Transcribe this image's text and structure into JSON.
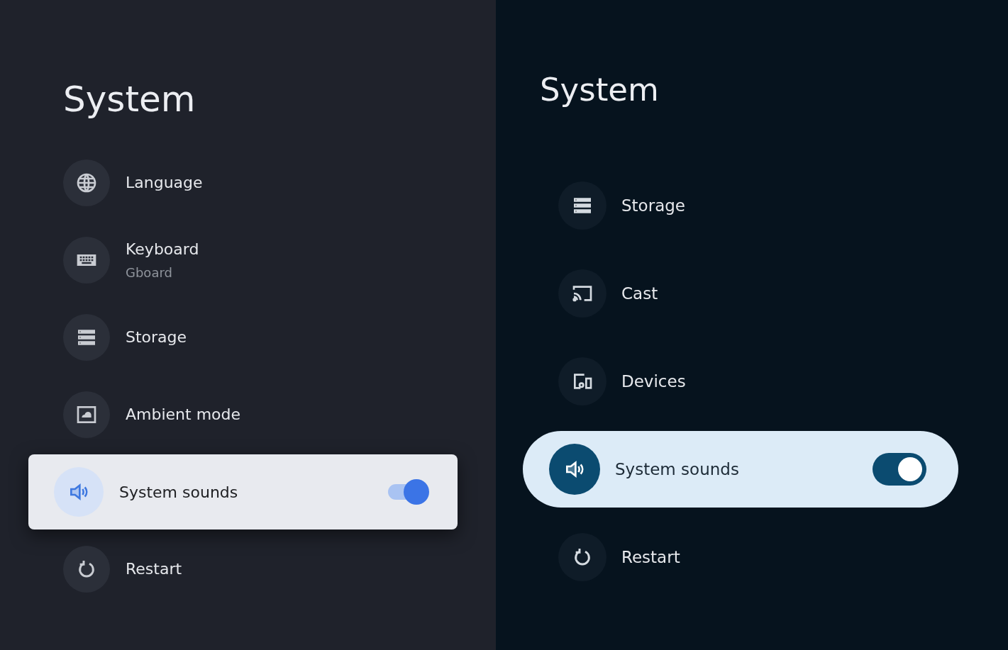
{
  "panels": [
    {
      "kind": "classic",
      "title": "System",
      "items": [
        {
          "kind": "globe",
          "label": "Language",
          "selected": false
        },
        {
          "kind": "keyboard",
          "label": "Keyboard",
          "subtitle": "Gboard",
          "selected": false
        },
        {
          "kind": "storage",
          "label": "Storage",
          "selected": false
        },
        {
          "kind": "ambient",
          "label": "Ambient mode",
          "selected": false
        },
        {
          "kind": "speaker",
          "label": "System sounds",
          "selected": true,
          "toggle": {
            "on": true
          }
        },
        {
          "kind": "restart",
          "label": "Restart",
          "selected": false
        }
      ]
    },
    {
      "kind": "new",
      "title": "System",
      "items": [
        {
          "kind": "storage",
          "label": "Storage",
          "selected": false
        },
        {
          "kind": "cast",
          "label": "Cast",
          "selected": false
        },
        {
          "kind": "devices",
          "label": "Devices",
          "selected": false
        },
        {
          "kind": "speaker",
          "label": "System sounds",
          "selected": true,
          "toggle": {
            "on": true
          }
        },
        {
          "kind": "restart",
          "label": "Restart",
          "selected": false
        }
      ]
    }
  ]
}
